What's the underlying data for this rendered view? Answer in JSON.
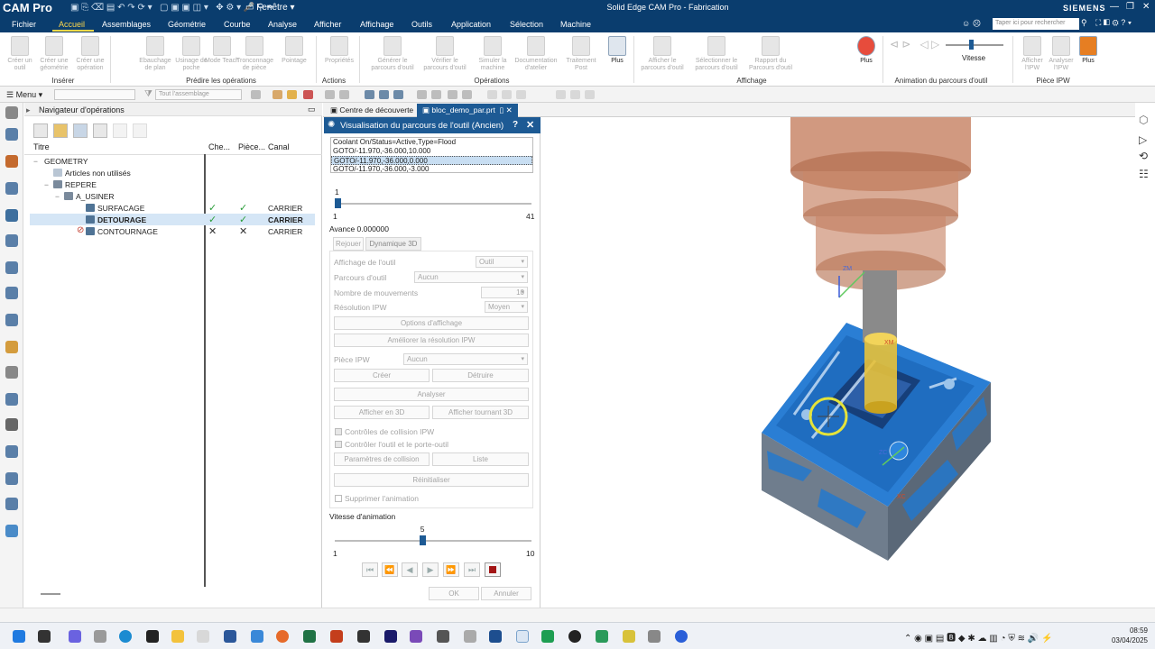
{
  "app_name": "CAM Pro",
  "window_title": "Solid Edge CAM Pro - Fabrication",
  "window_menu": "Fenêtre",
  "brand": "SIEMENS",
  "search_placeholder": "Taper ici pour rechercher",
  "menu": [
    "Fichier",
    "Accueil",
    "Assemblages",
    "Géométrie",
    "Courbe",
    "Analyse",
    "Afficher",
    "Affichage",
    "Outils",
    "Application",
    "Sélection",
    "Machine"
  ],
  "ribbon": {
    "buttons": [
      {
        "label": "Créer un outil"
      },
      {
        "label": "Créer une géométrie"
      },
      {
        "label": "Créer une opération"
      },
      {
        "label": "Ebauchage de plan"
      },
      {
        "label": "Usinage de poche"
      },
      {
        "label": "Mode Teach"
      },
      {
        "label": "Tronconnage de pièce"
      },
      {
        "label": "Pointage"
      },
      {
        "label": "Propriétés"
      },
      {
        "label": "Générer le parcours d'outil"
      },
      {
        "label": "Vérifier le parcours d'outil"
      },
      {
        "label": "Simuler la machine"
      },
      {
        "label": "Documentation d'atelier"
      },
      {
        "label": "Traitement Post"
      },
      {
        "label": "Plus"
      },
      {
        "label": "Afficher le parcours d'outil"
      },
      {
        "label": "Sélectionner le parcours d'outil"
      },
      {
        "label": "Rapport du Parcours d'outil"
      },
      {
        "label": "Plus"
      },
      {
        "label": "Vitesse"
      },
      {
        "label": "Afficher l'IPW"
      },
      {
        "label": "Analyser l'IPW"
      },
      {
        "label": "Plus"
      }
    ],
    "groups": [
      "Insérer",
      "Prédire les opérations",
      "Actions",
      "Opérations",
      "Affichage",
      "Animation du parcours d'outil",
      "Pièce IPW"
    ]
  },
  "toolbar2": {
    "menu_label": "Menu",
    "filter_placeholder": "",
    "assembly_filter": "Tout l'assemblage"
  },
  "navigator": {
    "title": "Navigateur d'opérations",
    "columns": [
      "Titre",
      "Che...",
      "Pièce...",
      "Canal"
    ],
    "rows": [
      {
        "name": "GEOMETRY",
        "check": "",
        "piece": "",
        "canal": ""
      },
      {
        "name": "Articles non utilisés",
        "check": "",
        "piece": "",
        "canal": ""
      },
      {
        "name": "REPERE",
        "check": "",
        "piece": "",
        "canal": ""
      },
      {
        "name": "A_USINER",
        "check": "",
        "piece": "",
        "canal": ""
      },
      {
        "name": "SURFACAGE",
        "check": "✓",
        "piece": "✓",
        "canal": "CARRIER"
      },
      {
        "name": "DETOURAGE",
        "check": "✓",
        "piece": "✓",
        "canal": "CARRIER"
      },
      {
        "name": "CONTOURNAGE",
        "check": "✕",
        "piece": "✕",
        "canal": "CARRIER"
      }
    ]
  },
  "tabs": [
    {
      "label": "Centre de découverte"
    },
    {
      "label": "bloc_demo_par.prt"
    }
  ],
  "dialog": {
    "title": "Visualisation du parcours de l'outil (Ancien)",
    "code_lines": [
      "Coolant On/Status=Active,Type=Flood",
      "GOTO/-11.970,-36.000,10.000",
      "GOTO/-11.970,-36.000,0.000",
      "GOTO/-11.970,-36.000,-3.000"
    ],
    "slider_top": {
      "value": "1",
      "min": "1",
      "max": "41",
      "fraction": 0.0
    },
    "avance": "Avance 0.000000",
    "mode_tabs": [
      "Rejouer",
      "Dynamique 3D"
    ],
    "affichage_outil_label": "Affichage de l'outil",
    "affichage_outil_value": "Outil",
    "parcours_outil_label": "Parcours d'outil",
    "parcours_outil_value": "Aucun",
    "nb_mouvements_label": "Nombre de mouvements",
    "nb_mouvements_value": "10",
    "resolution_label": "Résolution IPW",
    "resolution_value": "Moyen",
    "btn_options": "Options d'affichage",
    "btn_ameliorer": "Améliorer la résolution IPW",
    "piece_ipw_label": "Pièce IPW",
    "piece_ipw_value": "Aucun",
    "btn_creer": "Créer",
    "btn_detruire": "Détruire",
    "btn_analyser": "Analyser",
    "btn_afficher3d": "Afficher en 3D",
    "btn_afficher_tournant": "Afficher tournant 3D",
    "chk_collision": "Contrôles de collision IPW",
    "chk_porte_outil": "Contrôler l'outil et le porte-outil",
    "btn_parametres": "Paramètres de collision",
    "btn_liste": "Liste",
    "btn_reinitialiser": "Réinitialiser",
    "chk_supprimer": "Supprimer l'animation",
    "vitesse_label": "Vitesse d'animation",
    "speed": {
      "value": "5",
      "min": "1",
      "max": "10",
      "fraction": 0.4444
    },
    "btn_ok": "OK",
    "btn_annuler": "Annuler"
  },
  "viewport_labels": {
    "zm": "ZM",
    "xm": "XM",
    "zc": "ZC",
    "xc": "XC"
  },
  "clock": {
    "time": "08:59",
    "date": "03/04/2025"
  },
  "colors": {
    "titlebar": "#0a3d6e",
    "accent": "#1d5a94",
    "active_menu": "#ffd84a"
  }
}
